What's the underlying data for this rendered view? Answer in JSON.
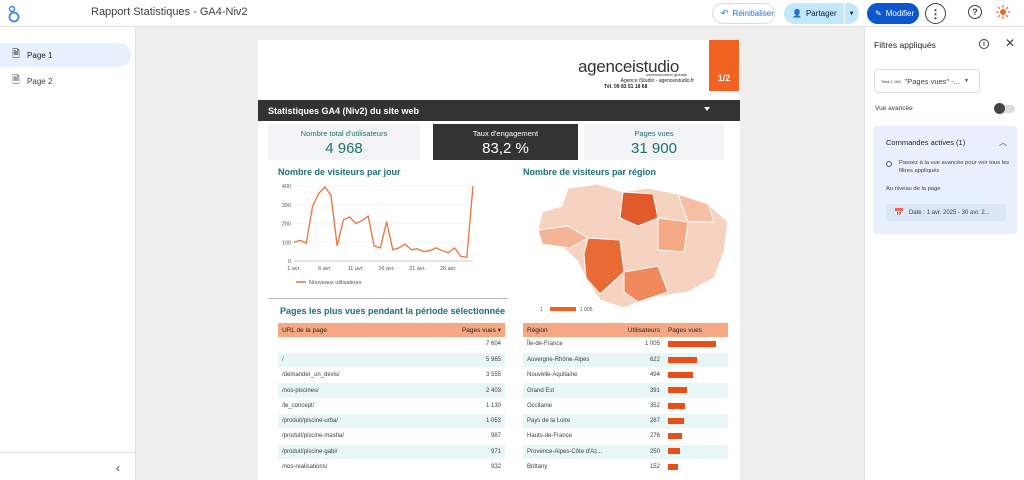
{
  "header": {
    "doc_title": "Rapport Statistiques - GA4-Niv2",
    "reset_label": "Réinitialiser",
    "share_label": "Partager",
    "edit_label": "Modifier"
  },
  "nav": {
    "pages": [
      {
        "label": "Page 1",
        "active": true
      },
      {
        "label": "Page 2",
        "active": false
      }
    ]
  },
  "report": {
    "brand_name": "agenceistudio",
    "brand_tagline": "communication globale",
    "brand_contact": "Agence iStudio - agenceistudio.fr",
    "brand_tel": "Tél. 09 83 51 18 68",
    "page_indicator": "1/2",
    "section_title": "Statistiques GA4 (Niv2) du site web",
    "kpis": [
      {
        "label": "Nombre total d'utilisateurs",
        "value": "4 968"
      },
      {
        "label": "Taux d'engagement",
        "value": "83,2 %"
      },
      {
        "label": "Pages vues",
        "value": "31 900"
      }
    ],
    "line_title": "Nombre de visiteurs par jour",
    "map_title": "Nombre de visiteurs par région",
    "map_legend_min": "1",
    "map_legend_max": "1 005",
    "pages_title": "Pages les plus vues pendant la période sélectionnée",
    "pages_table": {
      "col_url": "URL de la page",
      "col_views": "Pages vues",
      "rows": [
        {
          "url": "",
          "views": "7 604"
        },
        {
          "url": "/",
          "views": "5 965"
        },
        {
          "url": "/demander_un_devis/",
          "views": "3 555"
        },
        {
          "url": "/nos-piscines/",
          "views": "2 403"
        },
        {
          "url": "/le_concept/",
          "views": "1 130"
        },
        {
          "url": "/produit/piscine-urba/",
          "views": "1 053"
        },
        {
          "url": "/produit/piscine-masha/",
          "views": "987"
        },
        {
          "url": "/produit/piscine-gabi/",
          "views": "971"
        },
        {
          "url": "/nos-realisations/",
          "views": "932"
        }
      ]
    },
    "region_table": {
      "col_region": "Région",
      "col_users": "Utilisateurs",
      "col_pv": "Pages vues",
      "rows": [
        {
          "region": "Île-de-France",
          "users": "1 005",
          "bar": 1.0
        },
        {
          "region": "Auvergne-Rhône-Alpes",
          "users": "622",
          "bar": 0.6
        },
        {
          "region": "Nouvelle-Aquitaine",
          "users": "494",
          "bar": 0.52
        },
        {
          "region": "Grand Est",
          "users": "391",
          "bar": 0.4
        },
        {
          "region": "Occitanie",
          "users": "352",
          "bar": 0.36
        },
        {
          "region": "Pays de la Loire",
          "users": "287",
          "bar": 0.33
        },
        {
          "region": "Hauts-de-France",
          "users": "276",
          "bar": 0.3
        },
        {
          "region": "Provence-Alpes-Côte d'Az...",
          "users": "250",
          "bar": 0.26
        },
        {
          "region": "Brittany",
          "users": "152",
          "bar": 0.2
        }
      ]
    }
  },
  "chart_data": {
    "type": "line",
    "title": "Nombre de visiteurs par jour",
    "x_ticks": [
      "1 avr.",
      "6 avr.",
      "11 avr.",
      "16 avr.",
      "21 avr.",
      "26 avr."
    ],
    "y_ticks": [
      "0",
      "100",
      "200",
      "300",
      "400"
    ],
    "ylim": [
      0,
      400
    ],
    "series": [
      {
        "name": "Nouveaux utilisateurs",
        "color": "#e8743b",
        "values": [
          100,
          110,
          95,
          290,
          360,
          395,
          350,
          80,
          220,
          235,
          200,
          215,
          240,
          80,
          70,
          210,
          60,
          70,
          90,
          60,
          65,
          50,
          55,
          70,
          55,
          45,
          70,
          25,
          20,
          400
        ]
      }
    ]
  },
  "right_panel": {
    "title": "Filtres appliqués",
    "chip_mini": "Total 1,168",
    "chip_label": "\"Pages vues\" -...",
    "advanced_label": "Vue avancée",
    "card_title": "Commandes actives (1)",
    "card_text": "Passez à la vue avancée pour voir tous les filtres appliqués",
    "card_level": "Au niveau de la page",
    "card_date": "Date : 1 avr. 2025 - 30 avr. 2..."
  },
  "colors": {
    "accent": "#f26322",
    "teal": "#1e6f73",
    "primary": "#0b57d0"
  }
}
